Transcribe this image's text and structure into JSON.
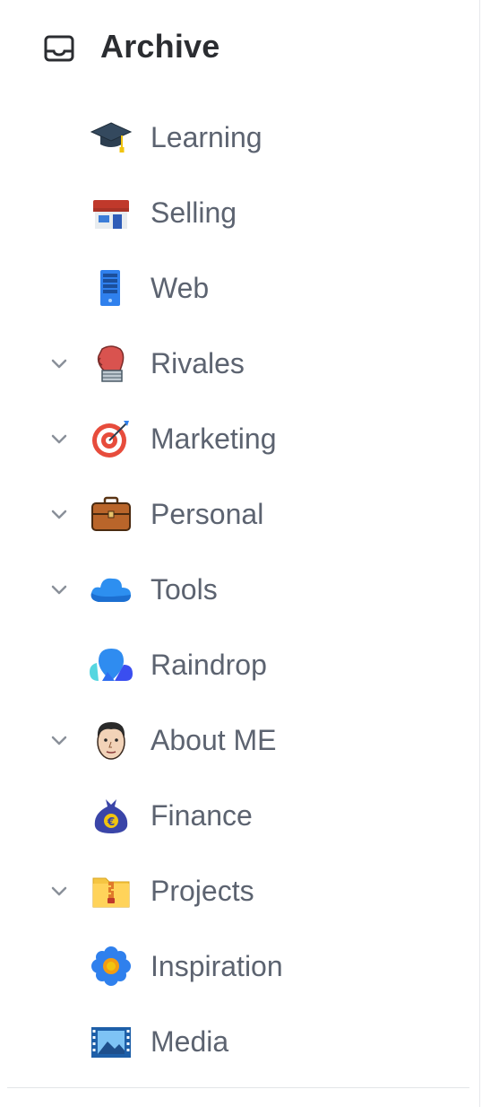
{
  "header": {
    "title": "Archive",
    "icon": "inbox-icon"
  },
  "items": [
    {
      "label": "Learning",
      "icon": "graduation-cap-icon",
      "expandable": false
    },
    {
      "label": "Selling",
      "icon": "store-icon",
      "expandable": false
    },
    {
      "label": "Web",
      "icon": "server-icon",
      "expandable": false
    },
    {
      "label": "Rivales",
      "icon": "boxing-glove-icon",
      "expandable": true
    },
    {
      "label": "Marketing",
      "icon": "target-icon",
      "expandable": true
    },
    {
      "label": "Personal",
      "icon": "briefcase-icon",
      "expandable": true
    },
    {
      "label": "Tools",
      "icon": "cloud-icon",
      "expandable": true
    },
    {
      "label": "Raindrop",
      "icon": "raindrop-logo-icon",
      "expandable": false
    },
    {
      "label": "About ME",
      "icon": "avatar-face-icon",
      "expandable": true
    },
    {
      "label": "Finance",
      "icon": "money-bag-icon",
      "expandable": false
    },
    {
      "label": "Projects",
      "icon": "zip-folder-icon",
      "expandable": true
    },
    {
      "label": "Inspiration",
      "icon": "flower-icon",
      "expandable": false
    },
    {
      "label": "Media",
      "icon": "film-image-icon",
      "expandable": false
    }
  ],
  "colors": {
    "title": "#2b2d31",
    "label": "#5c6370",
    "chevron": "#8a9099",
    "divider": "#e3e5e8"
  }
}
